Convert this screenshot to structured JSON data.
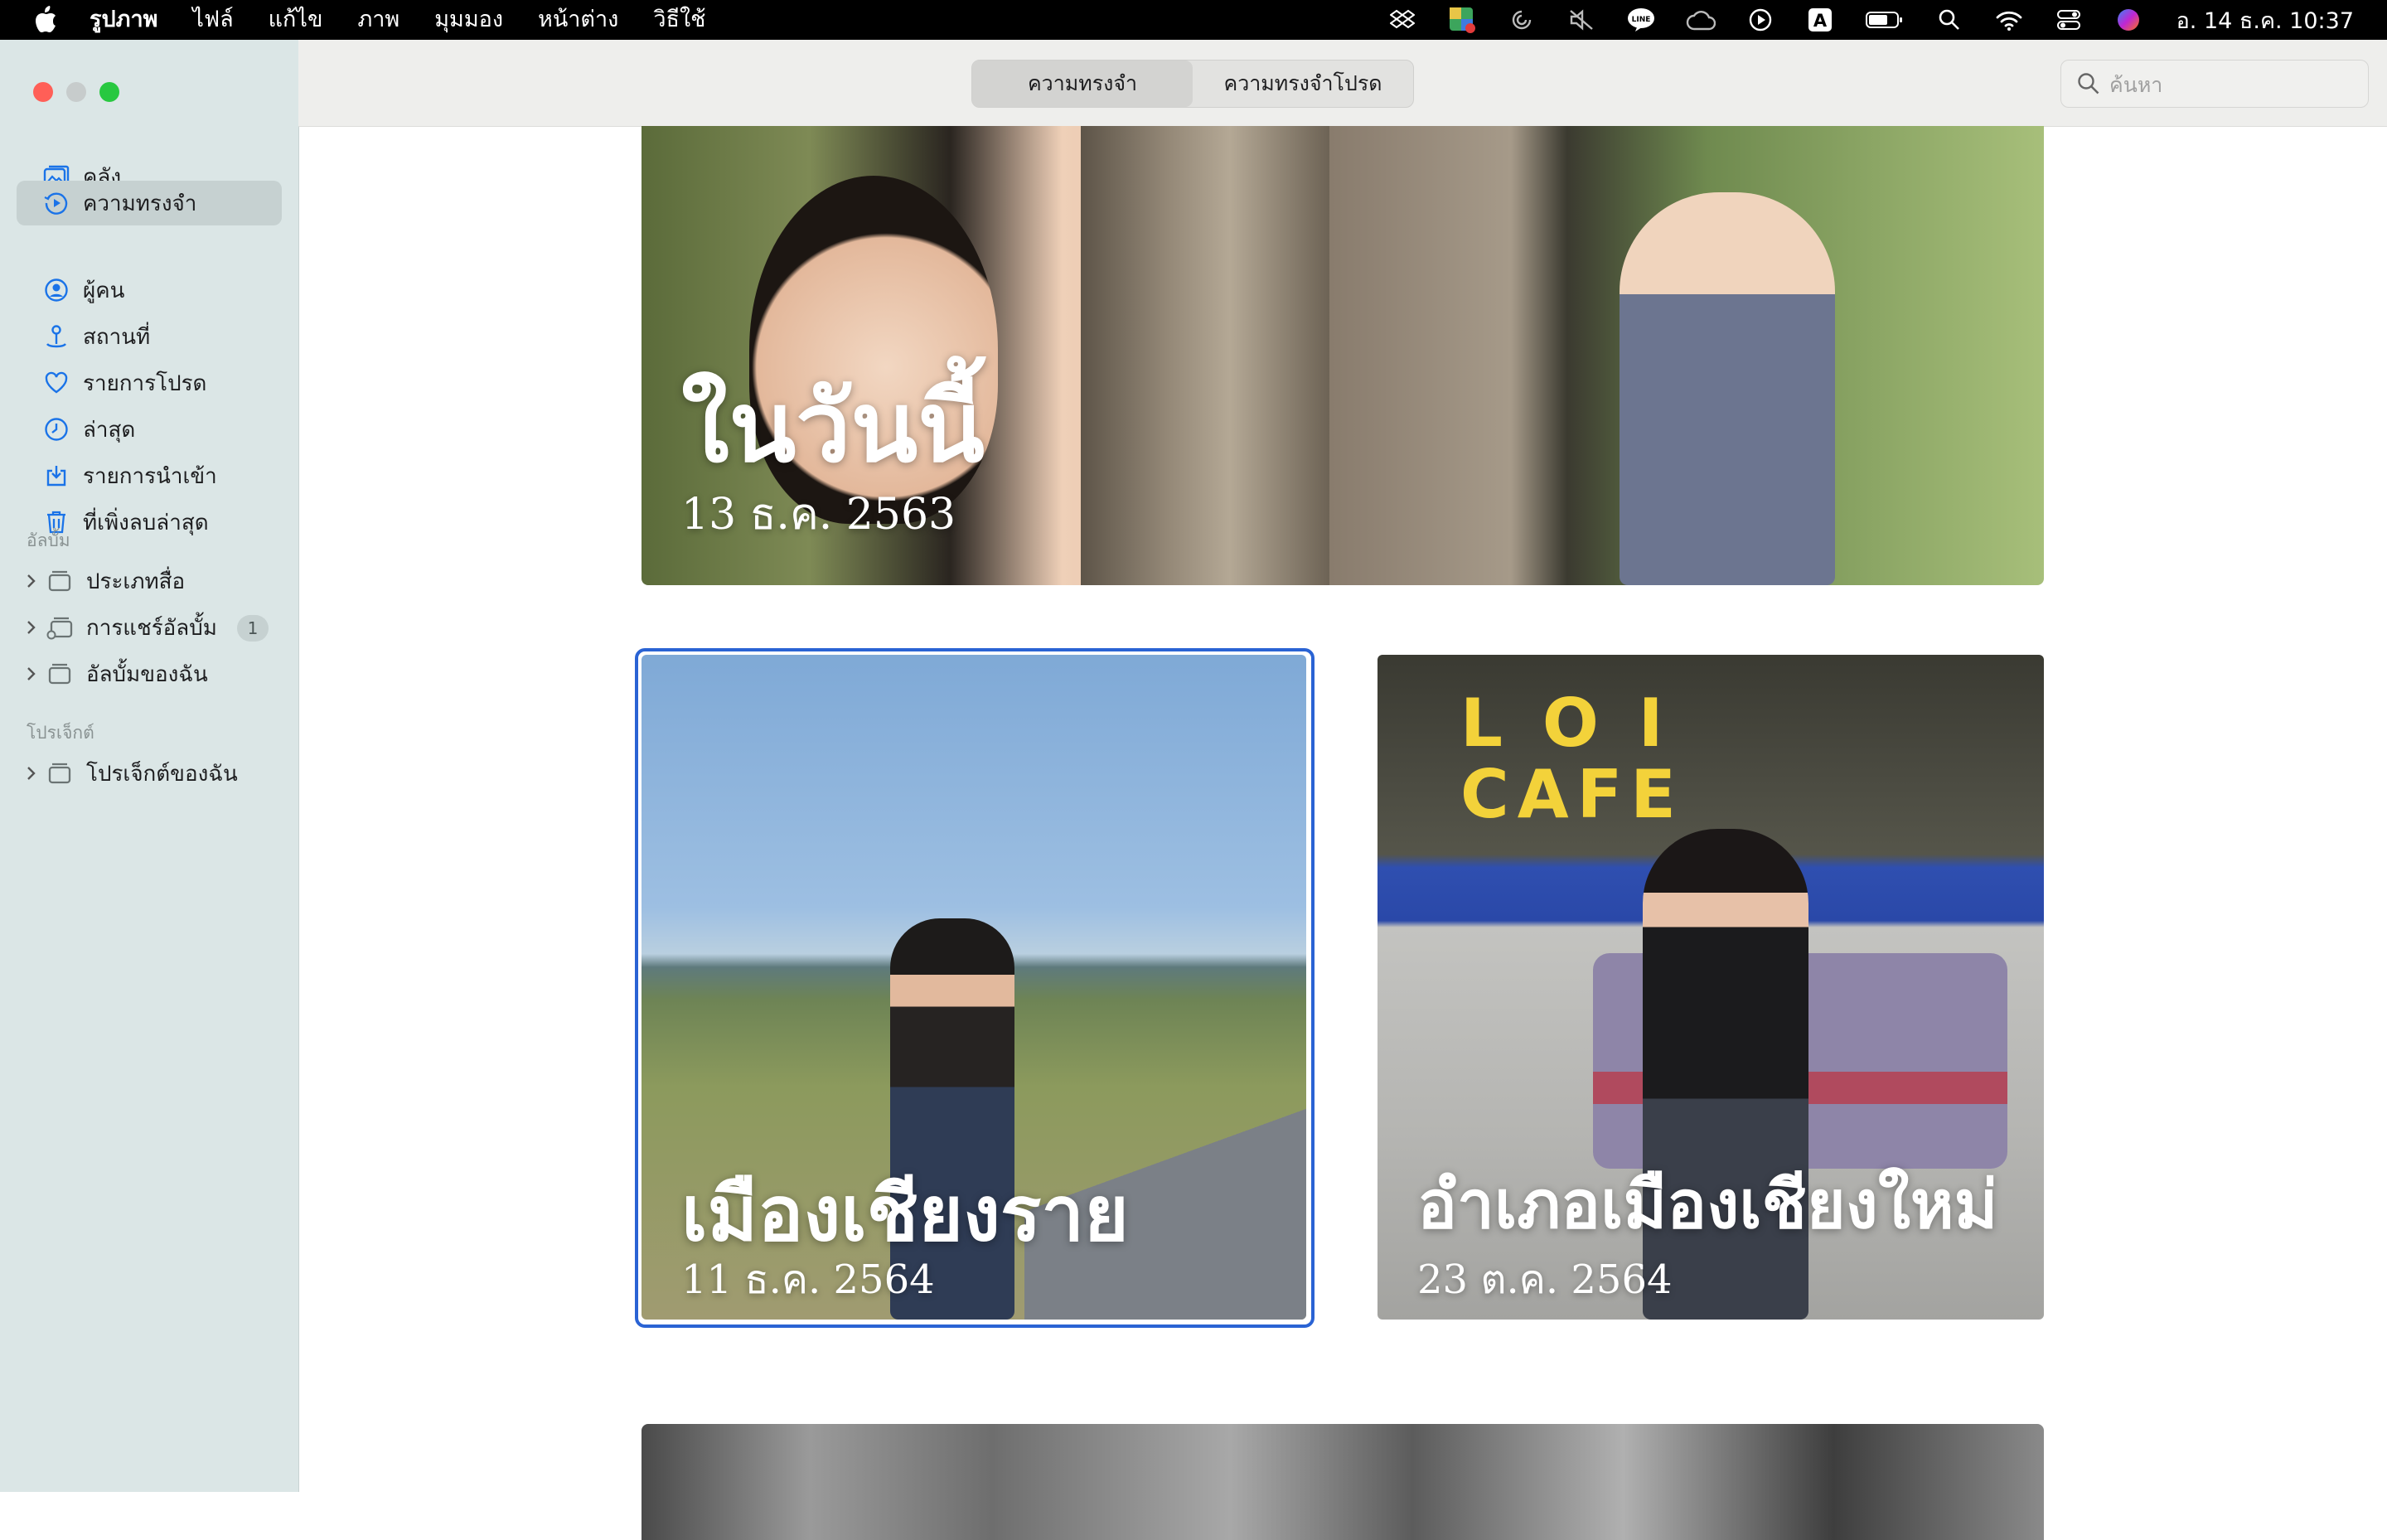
{
  "menubar": {
    "app_name": "รูปภาพ",
    "items": [
      "ไฟล์",
      "แก้ไข",
      "ภาพ",
      "มุมมอง",
      "หน้าต่าง",
      "วิธีใช้"
    ],
    "clock": "อ. 14 ธ.ค.  10:37"
  },
  "toolbar": {
    "segments": [
      "ความทรงจำ",
      "ความทรงจำโปรด"
    ],
    "active_segment": "ความทรงจำ",
    "search_placeholder": "ค้นหา"
  },
  "sidebar": {
    "library_items": [
      {
        "label": "คลัง",
        "icon": "photo-library-icon"
      },
      {
        "label": "ความทรงจำ",
        "icon": "memories-icon",
        "selected": true
      },
      {
        "label": "ผู้คน",
        "icon": "person-circle-icon"
      },
      {
        "label": "สถานที่",
        "icon": "map-pin-icon"
      },
      {
        "label": "รายการโปรด",
        "icon": "heart-icon"
      },
      {
        "label": "ล่าสุด",
        "icon": "clock-icon"
      },
      {
        "label": "รายการนำเข้า",
        "icon": "import-icon"
      },
      {
        "label": "ที่เพิ่งลบล่าสุด",
        "icon": "trash-icon"
      }
    ],
    "albums_header": "อัลบั้ม",
    "albums": [
      {
        "label": "ประเภทสื่อ",
        "icon": "folder-icon"
      },
      {
        "label": "การแชร์อัลบั้ม",
        "icon": "shared-album-icon",
        "badge": "1"
      },
      {
        "label": "อัลบั้มของฉัน",
        "icon": "folder-icon"
      }
    ],
    "projects_header": "โปรเจ็กต์",
    "projects": [
      {
        "label": "โปรเจ็กต์ของฉัน",
        "icon": "folder-icon"
      }
    ]
  },
  "memories": [
    {
      "title": "ในวันนี้",
      "date": "13 ธ.ค. 2563"
    },
    {
      "title": "เมืองเชียงราย",
      "date": "11 ธ.ค. 2564",
      "selected": true
    },
    {
      "title": "อำเภอเมืองเชียงใหม่",
      "date": "23 ต.ค. 2564"
    }
  ],
  "colors": {
    "sidebar_bg": "#dbe6e6",
    "accent": "#2a63d4",
    "menubar_bg": "#000000"
  }
}
